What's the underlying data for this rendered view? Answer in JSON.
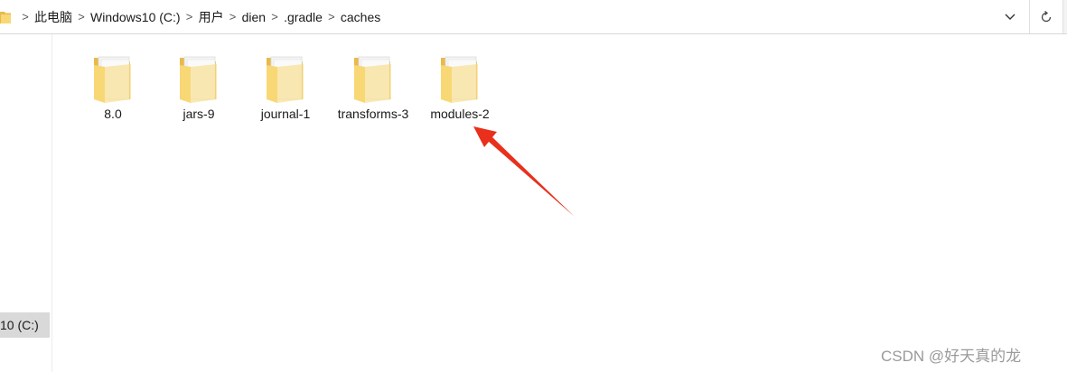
{
  "address_bar": {
    "breadcrumbs": [
      "此电脑",
      "Windows10 (C:)",
      "用户",
      "dien",
      ".gradle",
      "caches"
    ],
    "separator": ">",
    "dropdown_icon": "chevron-down-icon",
    "refresh_icon": "refresh-icon"
  },
  "nav_pane": {
    "selected_item": "10 (C:)"
  },
  "files": [
    {
      "name": "8.0",
      "type": "folder"
    },
    {
      "name": "jars-9",
      "type": "folder"
    },
    {
      "name": "journal-1",
      "type": "folder"
    },
    {
      "name": "transforms-3",
      "type": "folder"
    },
    {
      "name": "modules-2",
      "type": "folder"
    }
  ],
  "annotation": {
    "arrow_color": "#e8301c",
    "points_to": "modules-2"
  },
  "watermark": "CSDN @好天真的龙",
  "colors": {
    "folder_yellow": "#f8d775",
    "folder_dark": "#e9b949",
    "paper": "#f4f4f4",
    "selected_bg": "#d9d9d9"
  }
}
